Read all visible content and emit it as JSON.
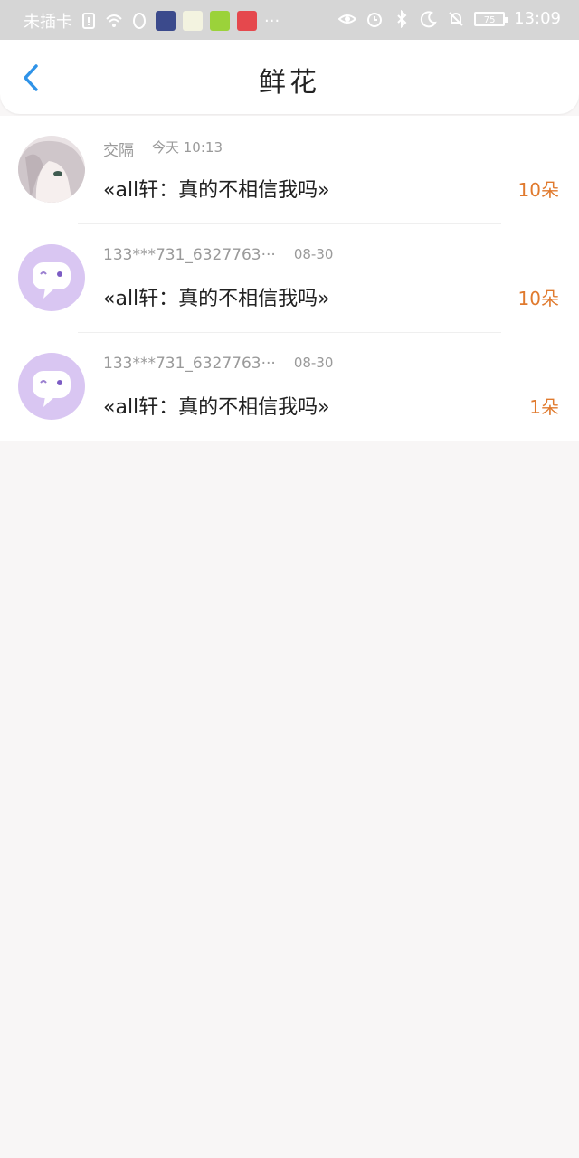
{
  "status_bar": {
    "carrier": "未插卡",
    "more": "···",
    "battery": "75",
    "time": "13:09"
  },
  "header": {
    "title": "鲜花"
  },
  "items": [
    {
      "name": "交隔",
      "time": "今天 10:13",
      "message": "«all轩：真的不相信我吗»",
      "count": "10朵"
    },
    {
      "name": "133***731_6327763···",
      "time": "08-30",
      "message": "«all轩：真的不相信我吗»",
      "count": "10朵"
    },
    {
      "name": "133***731_6327763···",
      "time": "08-30",
      "message": "«all轩：真的不相信我吗»",
      "count": "1朵"
    }
  ],
  "colors": {
    "accent": "#2f93e8",
    "count": "#e07a2e",
    "bot_avatar": "#d9c6f2"
  }
}
